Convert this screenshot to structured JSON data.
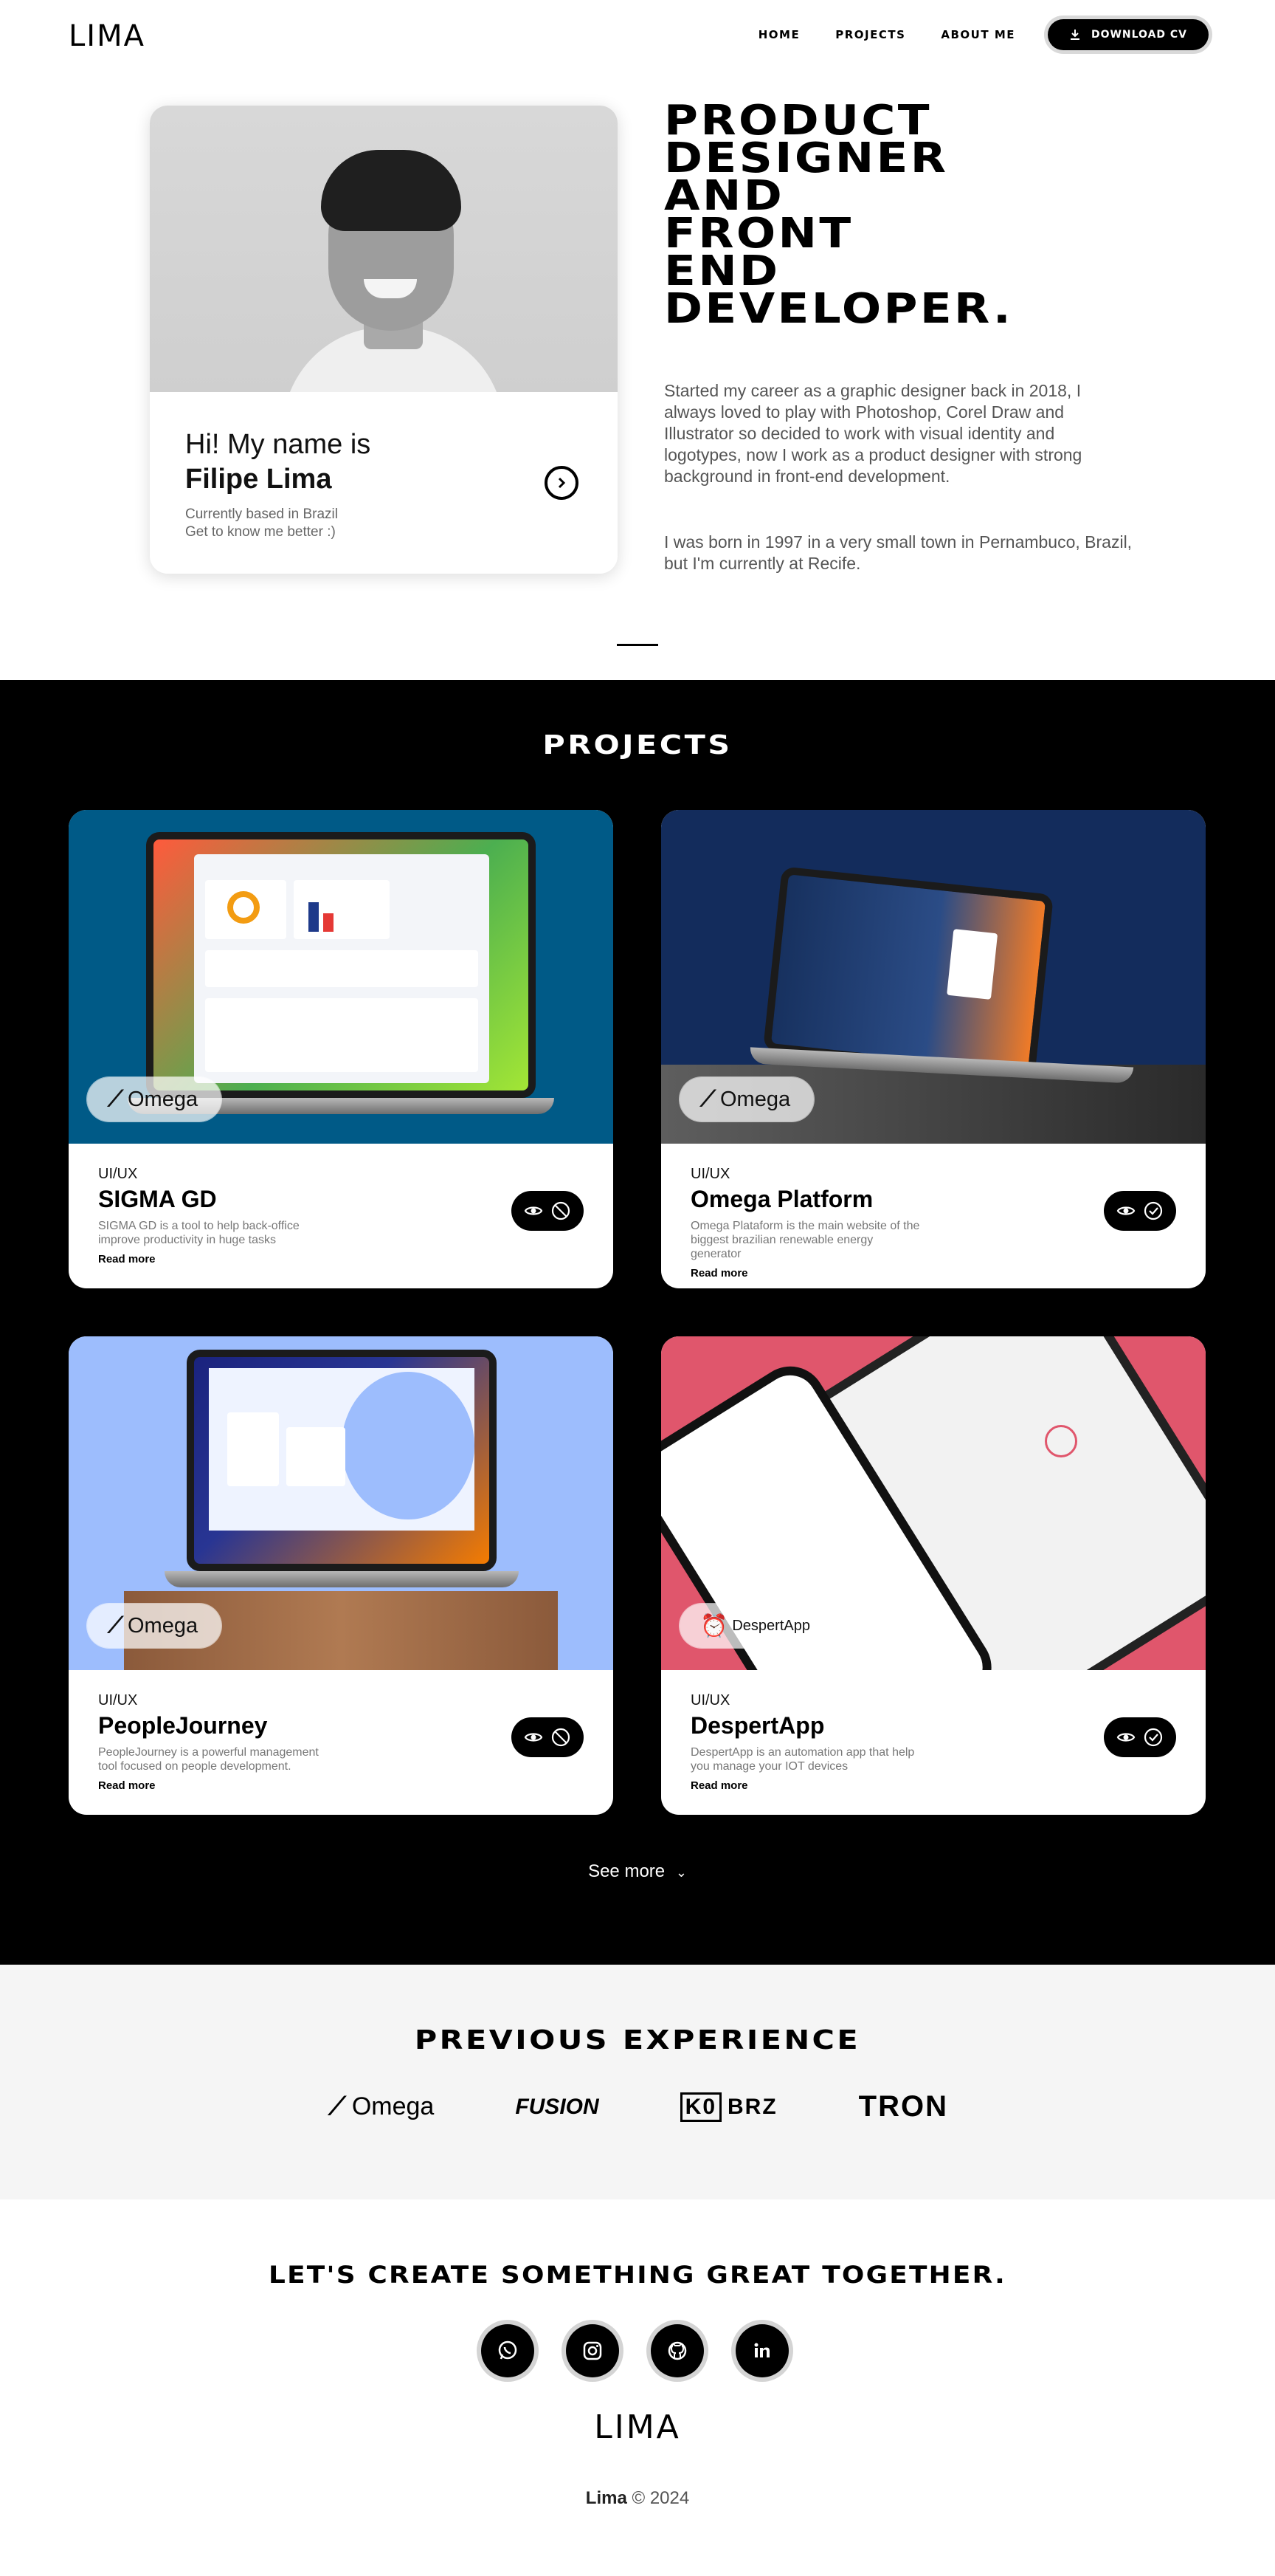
{
  "header": {
    "logo": "LIMA",
    "nav": [
      "HOME",
      "PROJECTS",
      "ABOUT ME"
    ],
    "cv_button": "DOWNLOAD CV",
    "cv_icon": "download-icon"
  },
  "hero": {
    "greeting": "Hi! My name is",
    "name": "Filipe Lima",
    "location": "Currently based in Brazil",
    "cta": "Get to know me better :)",
    "headline": [
      "PRODUCT",
      "DESIGNER",
      "AND",
      "FRONT",
      "END",
      "DEVELOPER."
    ],
    "bio_1": "Started my career as a graphic designer back in 2018, I always loved to play with Photoshop, Corel Draw and Illustrator so decided to work with visual identity and logotypes, now I work as a product designer with strong background in front-end development.",
    "bio_2": "I was born in 1997 in a very small town in Pernambuco, Brazil, but I'm currently at Recife."
  },
  "projects": {
    "title": "PROJECTS",
    "items": [
      {
        "badge": "Omega",
        "type": "UI/UX",
        "title": "SIGMA GD",
        "desc": "SIGMA GD is a tool to help back-office improve productivity in huge tasks",
        "more": "Read more",
        "bg": "#005a87"
      },
      {
        "badge": "Omega",
        "type": "UI/UX",
        "title": "Omega Platform",
        "desc": "Omega Plataform is the main website of the biggest brazilian renewable energy generator",
        "more": "Read more",
        "bg": "#132c5c"
      },
      {
        "badge": "Omega",
        "type": "UI/UX",
        "title": "PeopleJourney",
        "desc": "PeopleJourney is a powerful management tool focused on people development.",
        "more": "Read more",
        "bg": "#9dbdfd"
      },
      {
        "badge": "DespertApp",
        "type": "UI/UX",
        "title": "DespertApp",
        "desc": "DespertApp is an automation app that help you manage your IOT devices",
        "more": "Read more",
        "bg": "#e0566c"
      }
    ],
    "see_more": "See more"
  },
  "experience": {
    "title": "PREVIOUS EXPERIENCE",
    "companies": [
      "Omega",
      "FUSION",
      "BRZ",
      "TRON"
    ]
  },
  "footer": {
    "cta": "LET'S CREATE SOMETHING GREAT TOGETHER.",
    "socials": [
      "whatsapp-icon",
      "instagram-icon",
      "github-icon",
      "linkedin-icon"
    ],
    "logo": "LIMA",
    "copyright_name": "Lima",
    "copyright_rest": "© 2024"
  }
}
